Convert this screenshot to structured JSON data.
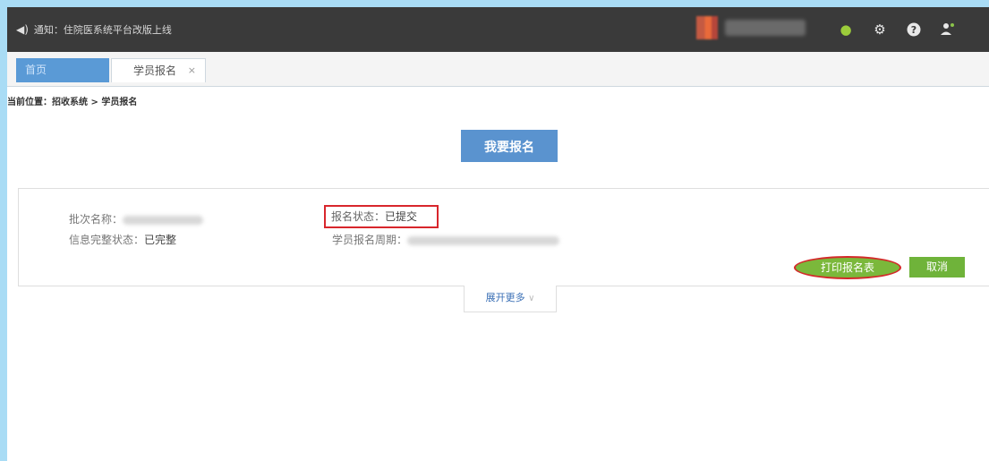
{
  "topbar": {
    "notice_icon": "speaker-icon",
    "notice_text": "通知：住院医系统平台改版上线",
    "user_name": "",
    "icons": [
      "wechat-icon",
      "gear-icon",
      "help-icon",
      "user-settings-icon"
    ],
    "accent": "#3a3a3a"
  },
  "tabs": {
    "home_label": "首页",
    "active_label": "学员报名",
    "close_symbol": "×"
  },
  "breadcrumb": {
    "text": "当前位置：招收系统 > 学员报名"
  },
  "main": {
    "signup_label": "我要报名",
    "signup_color": "#5a93cf"
  },
  "card": {
    "batch_label": "批次名称：",
    "batch_value": "",
    "info_label": "信息完整状态：",
    "info_value": "已完整",
    "status_label": "报名状态：",
    "status_value": "已提交",
    "period_label": "学员报名周期：",
    "period_value": "",
    "print_label": "打印报名表",
    "cancel_label": "取消",
    "btn_color": "#7bb83b",
    "highlight_color": "#d8262c"
  },
  "expand": {
    "label": "展开更多"
  }
}
